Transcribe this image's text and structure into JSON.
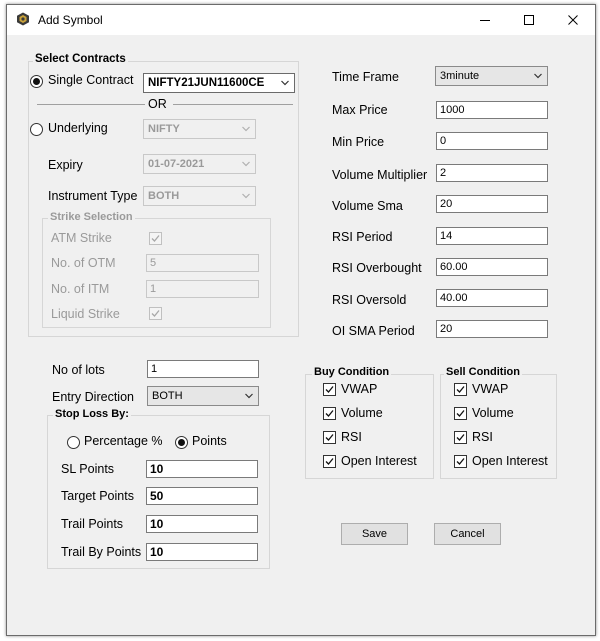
{
  "window": {
    "title": "Add Symbol",
    "minimize_glyph": "—",
    "maximize_glyph": "☐",
    "close_glyph": "✕"
  },
  "contracts": {
    "group_title": "Select Contracts",
    "single_label": "Single Contract",
    "single_selected": true,
    "single_value": "NIFTY21JUN11600CE",
    "or_label": "OR",
    "underlying_label": "Underlying",
    "underlying_value": "NIFTY",
    "expiry_label": "Expiry",
    "expiry_value": "01-07-2021",
    "instrument_label": "Instrument Type",
    "instrument_value": "BOTH"
  },
  "strike": {
    "group_title": "Strike Selection",
    "atm_label": "ATM Strike",
    "atm_checked": true,
    "otm_label": "No. of OTM",
    "otm_value": "5",
    "itm_label": "No. of ITM",
    "itm_value": "1",
    "liquid_label": "Liquid Strike",
    "liquid_checked": true
  },
  "params": {
    "timeframe_label": "Time Frame",
    "timeframe_value": "3minute",
    "max_price_label": "Max Price",
    "max_price_value": "1000",
    "min_price_label": "Min Price",
    "min_price_value": "0",
    "vol_mult_label": "Volume Multiplier",
    "vol_mult_value": "2",
    "vol_sma_label": "Volume Sma",
    "vol_sma_value": "20",
    "rsi_period_label": "RSI Period",
    "rsi_period_value": "14",
    "rsi_ob_label": "RSI Overbought",
    "rsi_ob_value": "60.00",
    "rsi_os_label": "RSI Oversold",
    "rsi_os_value": "40.00",
    "oi_sma_label": "OI SMA Period",
    "oi_sma_value": "20"
  },
  "order": {
    "lots_label": "No of lots",
    "lots_value": "1",
    "direction_label": "Entry Direction",
    "direction_value": "BOTH"
  },
  "stoploss": {
    "group_title": "Stop Loss By:",
    "pct_label": "Percentage %",
    "points_label": "Points",
    "points_selected": true,
    "sl_label": "SL Points",
    "sl_value": "10",
    "target_label": "Target Points",
    "target_value": "50",
    "trail_label": "Trail Points",
    "trail_value": "10",
    "trailby_label": "Trail By Points",
    "trailby_value": "10"
  },
  "buy": {
    "group_title": "Buy Condition",
    "vwap": "VWAP",
    "volume": "Volume",
    "rsi": "RSI",
    "oi": "Open Interest"
  },
  "sell": {
    "group_title": "Sell Condition",
    "vwap": "VWAP",
    "volume": "Volume",
    "rsi": "RSI",
    "oi": "Open Interest"
  },
  "actions": {
    "save_label": "Save",
    "cancel_label": "Cancel"
  },
  "colors": {
    "window_bg": "#f0f0f0",
    "disabled_text": "#9a9a9a"
  }
}
